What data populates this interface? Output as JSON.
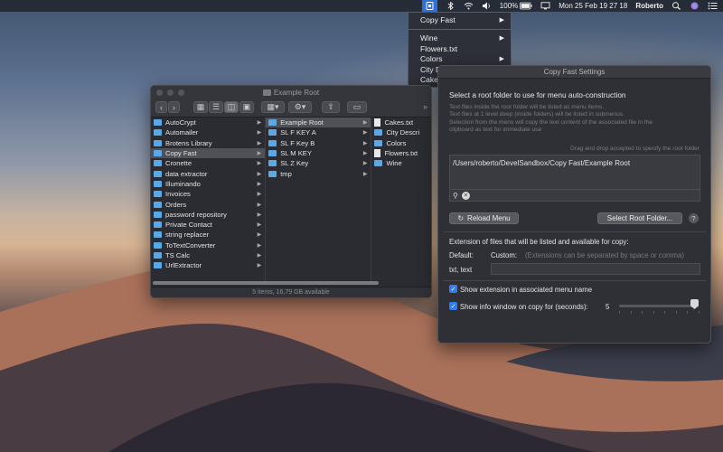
{
  "menubar": {
    "battery": "100%",
    "datetime": "Mon 25 Feb  19 27 18",
    "user": "Roberto",
    "icons": [
      "app-status-icon",
      "bluetooth-icon",
      "wifi-icon",
      "volume-icon",
      "battery-icon",
      "display-icon",
      "search-icon",
      "siri-icon",
      "notification-center-icon"
    ]
  },
  "dropdown": {
    "items": [
      {
        "label": "Copy Fast",
        "submenu": true
      },
      {
        "label": "Wine",
        "submenu": true
      },
      {
        "label": "Flowers.txt",
        "submenu": false
      },
      {
        "label": "Colors",
        "submenu": true
      },
      {
        "label": "City Description",
        "submenu": true
      },
      {
        "label": "Cakes.txt",
        "submenu": false
      }
    ]
  },
  "finder": {
    "title": "Example Root",
    "col1": [
      "AutoCrypt",
      "Automailer",
      "Brotens Library",
      "Copy Fast",
      "Cronette",
      "data extractor",
      "Illuminando",
      "Invoices",
      "Orders",
      "password  repository",
      "Private Contact",
      "string replacer",
      "ToTextConverter",
      "TS Calc",
      "UrlExtractor"
    ],
    "col1_selected": 3,
    "col2": [
      "Example Root",
      "SL F KEY A",
      "SL F Key B",
      "SL M KEY",
      "SL Z Key",
      "tmp"
    ],
    "col2_selected": 0,
    "col3": [
      {
        "label": "Cakes.txt",
        "type": "file"
      },
      {
        "label": "City Descri",
        "type": "folder"
      },
      {
        "label": "Colors",
        "type": "folder"
      },
      {
        "label": "Flowers.txt",
        "type": "file"
      },
      {
        "label": "Wine",
        "type": "folder"
      }
    ],
    "status": "5 items, 16,79 GB available"
  },
  "settings": {
    "title": "Copy Fast Settings",
    "heading": "Select a root folder to use for menu auto-construction",
    "note_lines": [
      "Text files inside the root folder will be listed as menu items.",
      "Text files at 1 level deep (inside folders) will be listed in submenus.",
      "Selection from the menu will copy the text content of the associated file in the",
      "clipboard as text for immediate use"
    ],
    "drag_note": "Drag and drop accepted to specify the root folder",
    "path": "/Users/roberto/DevelSandbox/Copy Fast/Example Root",
    "reload_label": "Reload Menu",
    "select_label": "Select Root Folder...",
    "help_label": "?",
    "extension_heading": "Extension of files that will be listed and available for copy:",
    "default_label": "Default:",
    "custom_label": "Custom:",
    "custom_placeholder": "(Extensions can be separated by space or comma)",
    "default_value": "txt, text",
    "show_extension_label": "Show extension in associated menu name",
    "show_extension_checked": true,
    "show_info_label": "Show info window on copy for (seconds):",
    "show_info_checked": true,
    "seconds_value": "5",
    "slider_fraction": 1.0
  },
  "colors": {
    "accent": "#2f7df0",
    "folder": "#5aa8e6",
    "menu_highlight": "#2f6fd6"
  }
}
